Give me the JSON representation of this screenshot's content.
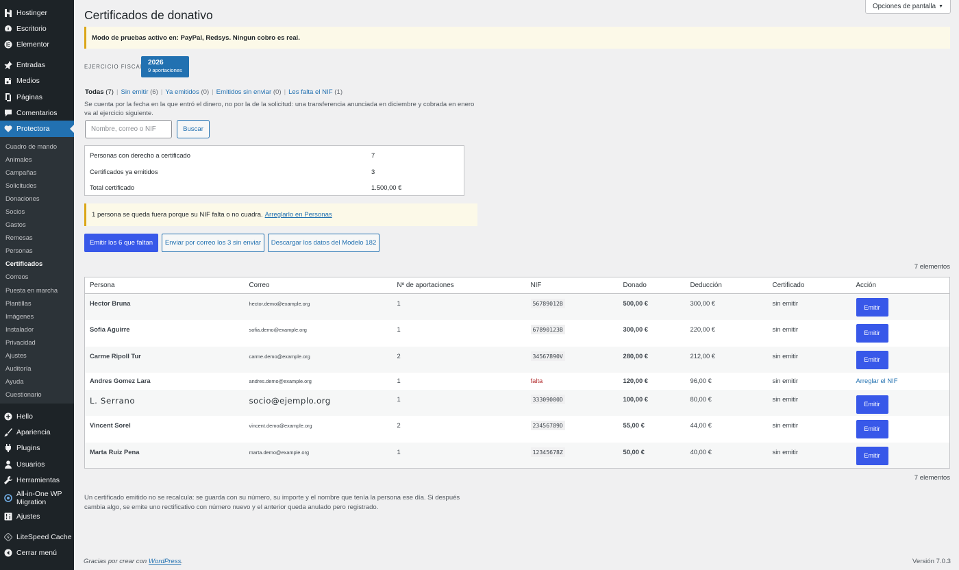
{
  "sidebar": {
    "top": [
      {
        "label": "Hostinger",
        "icon": "hostinger-icon"
      },
      {
        "label": "Escritorio",
        "icon": "dashboard-icon"
      },
      {
        "label": "Elementor",
        "icon": "elementor-icon"
      }
    ],
    "content": [
      {
        "label": "Entradas",
        "icon": "pin-icon"
      },
      {
        "label": "Medios",
        "icon": "media-icon"
      },
      {
        "label": "Páginas",
        "icon": "pages-icon"
      },
      {
        "label": "Comentarios",
        "icon": "comments-icon"
      },
      {
        "label": "Protectora",
        "icon": "heart-icon"
      }
    ],
    "submenu": [
      "Cuadro de mando",
      "Animales",
      "Campañas",
      "Solicitudes",
      "Donaciones",
      "Socios",
      "Gastos",
      "Remesas",
      "Personas",
      "Certificados",
      "Correos",
      "Puesta en marcha",
      "Plantillas",
      "Imágenes",
      "Instalador",
      "Privacidad",
      "Ajustes",
      "Auditoría",
      "Ayuda",
      "Cuestionario"
    ],
    "current_sub": "Certificados",
    "bottom": [
      {
        "label": "Hello",
        "icon": "plus-circle-icon"
      },
      {
        "label": "Apariencia",
        "icon": "brush-icon"
      },
      {
        "label": "Plugins",
        "icon": "plugin-icon"
      },
      {
        "label": "Usuarios",
        "icon": "user-icon"
      },
      {
        "label": "Herramientas",
        "icon": "wrench-icon"
      },
      {
        "label": "All-in-One WP Migration",
        "icon": "migration-icon"
      },
      {
        "label": "Ajustes",
        "icon": "settings-icon"
      }
    ],
    "cache": {
      "label": "LiteSpeed Cache",
      "icon": "litespeed-icon"
    },
    "collapse": {
      "label": "Cerrar menú",
      "icon": "collapse-icon"
    }
  },
  "screen_options": "Opciones de pantalla",
  "page_title": "Certificados de donativo",
  "test_notice": "Modo de pruebas activo en: PayPal, Redsys. Ningun cobro es real.",
  "fiscal_year": {
    "label": "Ejercicio fiscal",
    "year": "2026",
    "count": "9 aportaciones"
  },
  "filters": [
    {
      "label": "Todas",
      "count": "(7)"
    },
    {
      "label": "Sin emitir",
      "count": "(6)"
    },
    {
      "label": "Ya emitidos",
      "count": "(0)"
    },
    {
      "label": "Emitidos sin enviar",
      "count": "(0)"
    },
    {
      "label": "Les falta el NIF",
      "count": "(1)"
    }
  ],
  "description": "Se cuenta por la fecha en la que entró el dinero, no por la de la solicitud: una transferencia anunciada en diciembre y cobrada en enero va al ejercicio siguiente.",
  "search": {
    "placeholder": "Nombre, correo o NIF",
    "button": "Buscar"
  },
  "summary": [
    {
      "label": "Personas con derecho a certificado",
      "value": "7"
    },
    {
      "label": "Certificados ya emitidos",
      "value": "3"
    },
    {
      "label": "Total certificado",
      "value": "1.500,00 €"
    }
  ],
  "nif_notice": {
    "text": "1 persona se queda fuera porque su NIF falta o no cuadra.",
    "link": "Arreglarlo en Personas"
  },
  "actions": {
    "emit": "Emitir los 6 que faltan",
    "send": "Enviar por correo los 3 sin enviar",
    "download": "Descargar los datos del Modelo 182"
  },
  "items_count": "7 elementos",
  "table": {
    "headers": [
      "Persona",
      "Correo",
      "Nº de aportaciones",
      "NIF",
      "Donado",
      "Deducción",
      "Certificado",
      "Acción"
    ],
    "rows": [
      {
        "name": "Hector Bruna",
        "email": "hector.demo@example.org",
        "count": "1",
        "nif": "56789012B",
        "donated": "500,00 €",
        "deduction": "300,00 €",
        "status": "sin emitir",
        "action": "Emitir"
      },
      {
        "name": "Sofia Aguirre",
        "email": "sofia.demo@example.org",
        "count": "1",
        "nif": "67890123B",
        "donated": "300,00 €",
        "deduction": "220,00 €",
        "status": "sin emitir",
        "action": "Emitir"
      },
      {
        "name": "Carme Ripoll Tur",
        "email": "carme.demo@example.org",
        "count": "2",
        "nif": "34567890V",
        "donated": "280,00 €",
        "deduction": "212,00 €",
        "status": "sin emitir",
        "action": "Emitir"
      },
      {
        "name": "Andres Gomez Lara",
        "email": "andres.demo@example.org",
        "count": "1",
        "nif": "falta",
        "donated": "120,00 €",
        "deduction": "96,00 €",
        "status": "sin emitir",
        "action": "Arreglar el NIF"
      },
      {
        "name": "L. Serrano",
        "email": "socio@ejemplo.org",
        "count": "1",
        "nif": "33309000D",
        "donated": "100,00 €",
        "deduction": "80,00 €",
        "status": "sin emitir",
        "action": "Emitir"
      },
      {
        "name": "Vincent Sorel",
        "email": "vincent.demo@example.org",
        "count": "2",
        "nif": "23456789D",
        "donated": "55,00 €",
        "deduction": "44,00 €",
        "status": "sin emitir",
        "action": "Emitir"
      },
      {
        "name": "Marta Ruiz Pena",
        "email": "marta.demo@example.org",
        "count": "1",
        "nif": "12345678Z",
        "donated": "50,00 €",
        "deduction": "40,00 €",
        "status": "sin emitir",
        "action": "Emitir"
      }
    ]
  },
  "footnote": "Un certificado emitido no se recalcula: se guarda con su número, su importe y el nombre que tenía la persona ese día. Si después cambia algo, se emite uno rectificativo con número nuevo y el anterior queda anulado pero registrado.",
  "footer": {
    "thanks_prefix": "Gracias por crear con",
    "thanks_link": "WordPress",
    "thanks_suffix": ".",
    "version": "Versión 7.0.3"
  },
  "colors": {
    "sidebar": "#1d2327",
    "accent": "#2271b1",
    "primary_button": "#3858e9",
    "warning": "#dba617",
    "error": "#b32d2e"
  }
}
